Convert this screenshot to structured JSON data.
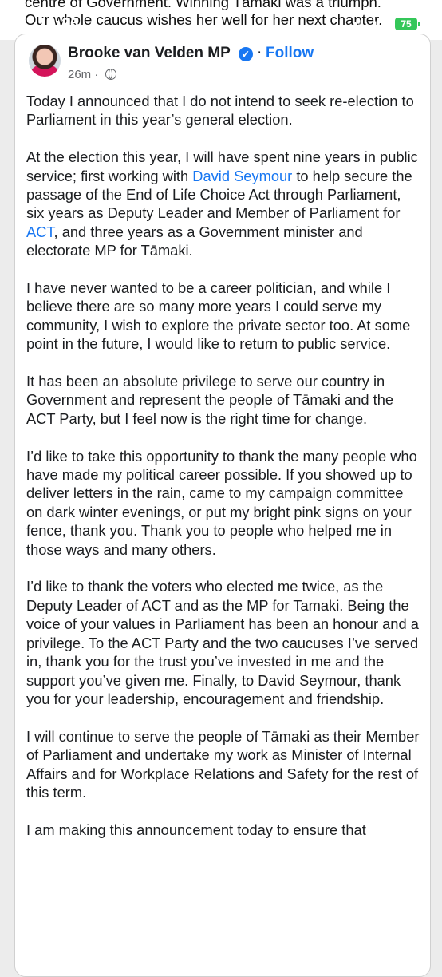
{
  "behind_post": {
    "line1": "centre of Government. Winning Tāmaki was a triumph.",
    "line2": "Our whole caucus wishes her well for her next chapter."
  },
  "status_bar": {
    "time": "12:26",
    "network": "4G",
    "battery": "75"
  },
  "post": {
    "author": "Brooke van Velden MP",
    "separator": "·",
    "follow_label": "Follow",
    "time_ago": "26m ·",
    "paragraphs": [
      [
        {
          "t": "Today I announced that I do not intend to seek re-election to Parliament in this year’s general election."
        }
      ],
      [
        {
          "t": "At the election this year, I will have spent nine years in public service; first working with "
        },
        {
          "t": "David Seymour",
          "link": true
        },
        {
          "t": " to help secure the passage of the End of Life Choice Act through Parliament, six years as Deputy Leader and Member of Parliament for "
        },
        {
          "t": "ACT",
          "link": true
        },
        {
          "t": ", and three years as a Government minister and electorate MP for Tāmaki."
        }
      ],
      [
        {
          "t": "I have never wanted to be a career politician, and while I believe there are so many more years I could serve my community, I wish to explore the private sector too. At some point in the future, I would like to return to public service."
        }
      ],
      [
        {
          "t": "It has been an absolute privilege to serve our country in Government and represent the people of Tāmaki and the ACT Party, but I feel now is the right time for change."
        }
      ],
      [
        {
          "t": "I’d like to take this opportunity to thank the many people who have made my political career possible. If you showed up to deliver letters in the rain, came to my campaign committee on dark winter evenings, or put my bright pink signs on your fence, thank you. Thank you to people who helped me in those ways and many others."
        }
      ],
      [
        {
          "t": "I’d like to thank the voters who elected me twice, as the Deputy Leader of ACT and as the MP for Tamaki. Being the voice of your values in Parliament has been an honour and a privilege. To the ACT Party and the two caucuses I’ve served in, thank you for the trust you’ve invested in me and the support you’ve given me. Finally, to David Seymour, thank you for your leadership, encouragement and friendship."
        }
      ],
      [
        {
          "t": "I will continue to serve the people of Tāmaki as their Member of Parliament and undertake my work as Minister of Internal Affairs and for Workplace Relations and Safety for the rest of this term."
        }
      ],
      [
        {
          "t": "I am making this announcement today to ensure that"
        }
      ]
    ]
  }
}
